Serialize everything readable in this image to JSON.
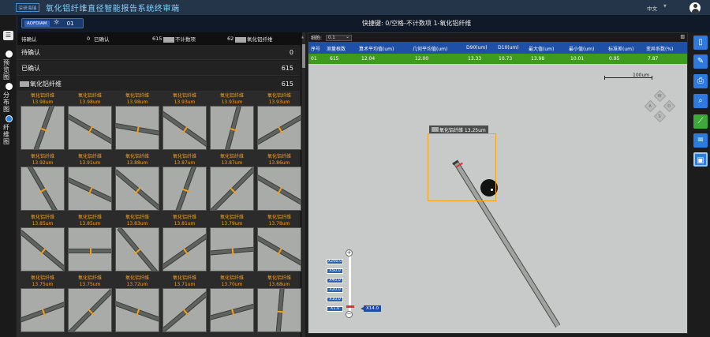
{
  "app": {
    "logo_text": "深研海瑞",
    "title": "氧化铝纤维直径智能报告系统终审端",
    "language": "中文"
  },
  "nav": {
    "items": [
      {
        "label": "预览图"
      },
      {
        "label": "分布图"
      },
      {
        "label": "纤维图"
      }
    ],
    "active_index": 2
  },
  "device": {
    "tag": "AOFDIAM",
    "channel": "01"
  },
  "hotkey_text": "快捷键: 0/空格-不计数项 1-氧化铝纤维",
  "summary": {
    "pending_label": "待确认",
    "pending_count": "0",
    "confirmed_label": "已确认",
    "confirmed_count": "615",
    "excluded_label": "不计数项",
    "excluded_count": "62",
    "fiber_label": "氧化铝纤维"
  },
  "sections": [
    {
      "label": "待确认",
      "count": "0"
    },
    {
      "label": "已确认",
      "count": "615"
    },
    {
      "label": "氧化铝纤维",
      "count": "615"
    }
  ],
  "thumbs": [
    {
      "label": "氧化铝纤维",
      "value": "13.98um"
    },
    {
      "label": "氧化铝纤维",
      "value": "13.98um"
    },
    {
      "label": "氧化铝纤维",
      "value": "13.98um"
    },
    {
      "label": "氧化铝纤维",
      "value": "13.93um"
    },
    {
      "label": "氧化铝纤维",
      "value": "13.93um"
    },
    {
      "label": "氧化铝纤维",
      "value": "13.93um"
    },
    {
      "label": "氧化铝纤维",
      "value": "13.92um"
    },
    {
      "label": "氧化铝纤维",
      "value": "13.91um"
    },
    {
      "label": "氧化铝纤维",
      "value": "13.88um"
    },
    {
      "label": "氧化铝纤维",
      "value": "13.87um"
    },
    {
      "label": "氧化铝纤维",
      "value": "13.87um"
    },
    {
      "label": "氧化铝纤维",
      "value": "13.86um"
    },
    {
      "label": "氧化铝纤维",
      "value": "13.85um"
    },
    {
      "label": "氧化铝纤维",
      "value": "13.85um"
    },
    {
      "label": "氧化铝纤维",
      "value": "13.83um"
    },
    {
      "label": "氧化铝纤维",
      "value": "13.81um"
    },
    {
      "label": "氧化铝纤维",
      "value": "13.79um"
    },
    {
      "label": "氧化铝纤维",
      "value": "13.78um"
    },
    {
      "label": "氧化铝纤维",
      "value": "13.75um"
    },
    {
      "label": "氧化铝纤维",
      "value": "13.75um"
    },
    {
      "label": "氧化铝纤维",
      "value": "13.72um"
    },
    {
      "label": "氧化铝纤维",
      "value": "13.71um"
    },
    {
      "label": "氧化铝纤维",
      "value": "13.70um"
    },
    {
      "label": "氧化铝纤维",
      "value": "13.68um"
    }
  ],
  "thumb_angles": [
    -70,
    30,
    10,
    35,
    -75,
    -30,
    60,
    25,
    40,
    -70,
    -45,
    30,
    40,
    0,
    50,
    -35,
    -5,
    30,
    -20,
    -45,
    20,
    -40,
    -15,
    -85
  ],
  "filter": {
    "label": "细胞:",
    "value": "0.1"
  },
  "table": {
    "headers": [
      "序号",
      "测量根数",
      "算术平均值(um)",
      "几何平均值(um)",
      "D90(um)",
      "D10(um)",
      "最大值(um)",
      "最小值(um)",
      "标准差(um)",
      "变异系数(%)"
    ],
    "row": [
      "01",
      "615",
      "12.04",
      "12.00",
      "13.33",
      "10.73",
      "13.98",
      "10.01",
      "0.95",
      "7.87"
    ]
  },
  "scale_label": "100um",
  "selection_label": "氧化铝纤维 13.25um",
  "zoom": {
    "levels": [
      "X200.0",
      "X50.0",
      "X40.0",
      "X20.0",
      "X10.0",
      "X1.0"
    ],
    "current": "X14.0"
  },
  "dpad": {
    "up": "W",
    "left": "A",
    "right": "D",
    "down": "S"
  }
}
